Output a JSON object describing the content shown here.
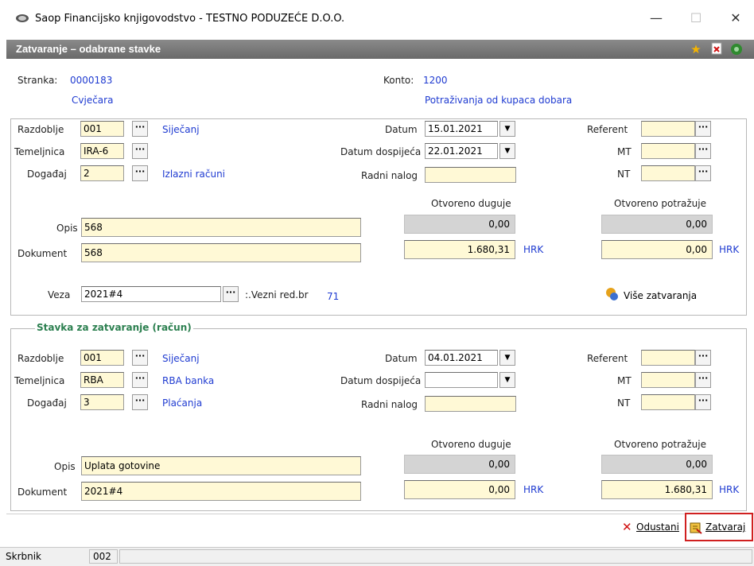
{
  "window": {
    "title": "Saop Financijsko knjigovodstvo - TESTNO PODUZEĆE D.O.O.",
    "minimize": "—",
    "maximize": "☐",
    "close": "✕"
  },
  "header": {
    "title": "Zatvaranje – odabrane stavke",
    "icons": [
      "star-icon",
      "close-doc-icon",
      "exit-icon"
    ]
  },
  "top": {
    "stranka_label": "Stranka:",
    "stranka_value": "0000183",
    "stranka_name": "Cvječara",
    "konto_label": "Konto:",
    "konto_value": "1200",
    "konto_name": "Potraživanja od kupaca dobara"
  },
  "doc": {
    "razdoblje_label": "Razdoblje",
    "razdoblje_value": "001",
    "razdoblje_name": "Siječanj",
    "temeljnica_label": "Temeljnica",
    "temeljnica_value": "IRA-6",
    "dogadaj_label": "Događaj",
    "dogadaj_value": "2",
    "dogadaj_name": "Izlazni računi",
    "datum_label": "Datum",
    "datum_value": "15.01.2021",
    "datum_dosp_label": "Datum dospijeća",
    "datum_dosp_value": "22.01.2021",
    "radni_nalog_label": "Radni nalog",
    "radni_nalog_value": "",
    "referent_label": "Referent",
    "mt_label": "MT",
    "nt_label": "NT",
    "otvoreno_duguje_label": "Otvoreno duguje",
    "otvoreno_potrazuje_label": "Otvoreno potražuje",
    "opis_label": "Opis",
    "opis_value": "568",
    "dokument_label": "Dokument",
    "dokument_value": "568",
    "od_grey": "0,00",
    "od_value": "1.680,31",
    "od_currency": "HRK",
    "op_grey": "0,00",
    "op_value": "0,00",
    "op_currency": "HRK",
    "veza_label": "Veza",
    "veza_value": "2021#4",
    "vezni_label": ":.Vezni red.br",
    "vezni_value": "71",
    "vise_zatvaranja": "Više zatvaranja"
  },
  "stavka": {
    "group_title": "Stavka za zatvaranje (račun)",
    "razdoblje_label": "Razdoblje",
    "razdoblje_value": "001",
    "razdoblje_name": "Siječanj",
    "temeljnica_label": "Temeljnica",
    "temeljnica_value": "RBA",
    "temeljnica_name": "RBA banka",
    "dogadaj_label": "Događaj",
    "dogadaj_value": "3",
    "dogadaj_name": "Plaćanja",
    "datum_label": "Datum",
    "datum_value": "04.01.2021",
    "datum_dosp_label": "Datum dospijeća",
    "datum_dosp_value": "",
    "radni_nalog_label": "Radni nalog",
    "referent_label": "Referent",
    "mt_label": "MT",
    "nt_label": "NT",
    "otvoreno_duguje_label": "Otvoreno duguje",
    "otvoreno_potrazuje_label": "Otvoreno potražuje",
    "opis_label": "Opis",
    "opis_value": "Uplata gotovine",
    "dokument_label": "Dokument",
    "dokument_value": "2021#4",
    "od_grey": "0,00",
    "od_value": "0,00",
    "od_currency": "HRK",
    "op_grey": "0,00",
    "op_value": "1.680,31",
    "op_currency": "HRK"
  },
  "footer": {
    "cancel_label": "Odustani",
    "close_label": "Zatvaraj"
  },
  "status": {
    "user_label": "Skrbnik",
    "code": "002"
  }
}
